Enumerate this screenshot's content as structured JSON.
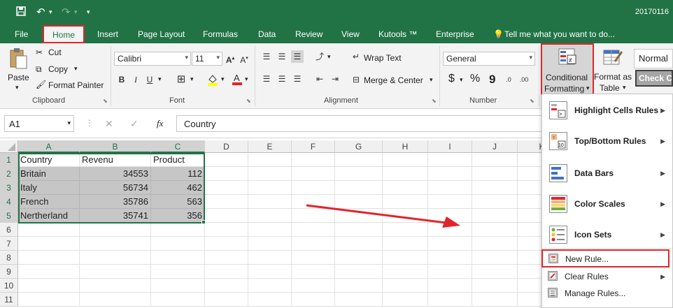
{
  "titlebar": {
    "filename": "20170116",
    "undo_icon": "undo-icon",
    "redo_icon": "redo-icon",
    "save_icon": "save-icon"
  },
  "tabs": [
    "File",
    "Home",
    "Insert",
    "Page Layout",
    "Formulas",
    "Data",
    "Review",
    "View",
    "Kutools ™",
    "Enterprise"
  ],
  "tell_me": "Tell me what you want to do...",
  "ribbon": {
    "paste": "Paste",
    "cut": "Cut",
    "copy": "Copy",
    "format_painter": "Format Painter",
    "clipboard_label": "Clipboard",
    "font_name": "Calibri",
    "font_size": "11",
    "font_label": "Font",
    "wrap_text": "Wrap Text",
    "merge_center": "Merge & Center",
    "alignment_label": "Alignment",
    "number_format": "General",
    "currency": "$",
    "percent": "%",
    "comma": "9",
    "number_label": "Number",
    "cf_line1": "Conditional",
    "cf_line2": "Formatting",
    "fat_line1": "Format as",
    "fat_line2": "Table",
    "style_normal": "Normal",
    "style_check": "Check Ce"
  },
  "formula_bar": {
    "name_box": "A1",
    "fx": "fx",
    "value": "Country"
  },
  "columns": [
    "A",
    "B",
    "C",
    "D",
    "E",
    "F",
    "G",
    "H",
    "I",
    "J",
    "K"
  ],
  "rows": [
    "1",
    "2",
    "3",
    "4",
    "5",
    "6",
    "7",
    "8",
    "9",
    "10",
    "11"
  ],
  "table": {
    "headers": [
      "Country",
      "Revenu",
      "Product"
    ],
    "data": [
      [
        "Britain",
        "34553",
        "112"
      ],
      [
        "Italy",
        "56734",
        "462"
      ],
      [
        "French",
        "35786",
        "563"
      ],
      [
        "Nertherland",
        "35741",
        "356"
      ]
    ]
  },
  "cf_menu": {
    "items": [
      {
        "label": "Highlight Cells Rules",
        "icon": "highlight-cells-icon"
      },
      {
        "label": "Top/Bottom Rules",
        "icon": "top-bottom-icon"
      },
      {
        "label": "Data Bars",
        "icon": "data-bars-icon"
      },
      {
        "label": "Color Scales",
        "icon": "color-scales-icon"
      },
      {
        "label": "Icon Sets",
        "icon": "icon-sets-icon"
      }
    ],
    "new_rule": "New Rule...",
    "clear_rules": "Clear Rules",
    "manage_rules": "Manage Rules..."
  },
  "colors": {
    "excel_green": "#217346",
    "highlight_red": "#e2242a",
    "selection_shade": "#c6c6c6"
  }
}
